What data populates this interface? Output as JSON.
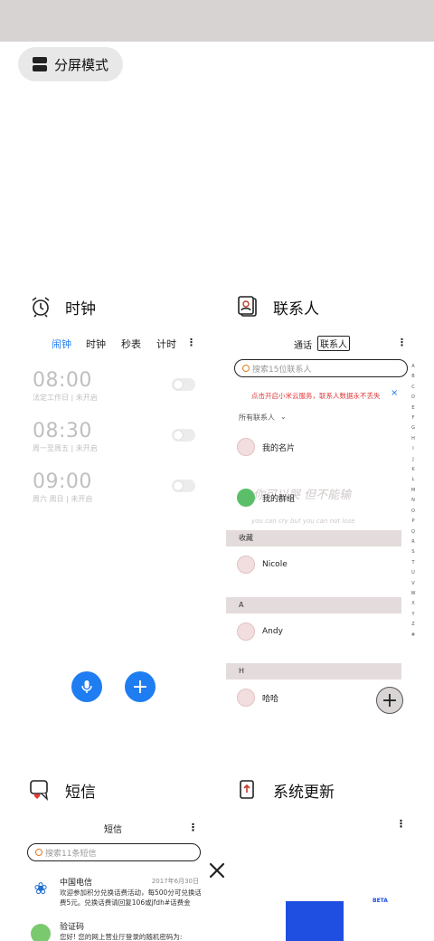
{
  "split_mode": {
    "label": "分屏模式"
  },
  "clock": {
    "title": "时钟",
    "tabs": [
      "闹钟",
      "时钟",
      "秒表",
      "计时"
    ],
    "alarms": [
      {
        "time": "08:00",
        "sub": "法定工作日 | 未开启"
      },
      {
        "time": "08:30",
        "sub": "周一至周五 | 未开启"
      },
      {
        "time": "09:00",
        "sub": "周六 周日 | 未开启"
      }
    ],
    "accent": "#1f7df2"
  },
  "contacts": {
    "title": "联系人",
    "tabs": [
      "通话",
      "联系人"
    ],
    "search_placeholder": "搜索15位联系人",
    "cloud_banner": "点击开启小米云服务，联系人数据永不丢失",
    "filter_label": "所有联系人",
    "my_card": "我的名片",
    "my_groups": "我的群组",
    "wallpaper_text_cn": "你可以哭 但不能输",
    "wallpaper_text_en": "you can cry but you can not lose",
    "sections": [
      {
        "header": "收藏",
        "items": [
          "Nicole"
        ]
      },
      {
        "header": "A",
        "items": [
          "Andy"
        ]
      },
      {
        "header": "H",
        "items": [
          "哈哈"
        ]
      }
    ],
    "alphabet": [
      "A",
      "B",
      "C",
      "D",
      "E",
      "F",
      "G",
      "H",
      "I",
      "J",
      "K",
      "L",
      "M",
      "N",
      "O",
      "P",
      "Q",
      "R",
      "S",
      "T",
      "U",
      "V",
      "W",
      "X",
      "Y",
      "Z",
      "#"
    ],
    "banner_color": "#e03b3b"
  },
  "sms": {
    "title": "短信",
    "header": "短信",
    "search_placeholder": "搜索11条短信",
    "messages": [
      {
        "sender": "中国电信",
        "date": "2017年6月30日",
        "text": "欢迎参加积分兑换话费活动，每500分可兑换话费5元。兑换话费请回复106或jfdh#话费金额…"
      },
      {
        "sender": "验证码",
        "text": "您好! 您的网上营业厅登录的随机密码为:"
      }
    ]
  },
  "update": {
    "title": "系统更新",
    "beta_label": "BETA"
  }
}
